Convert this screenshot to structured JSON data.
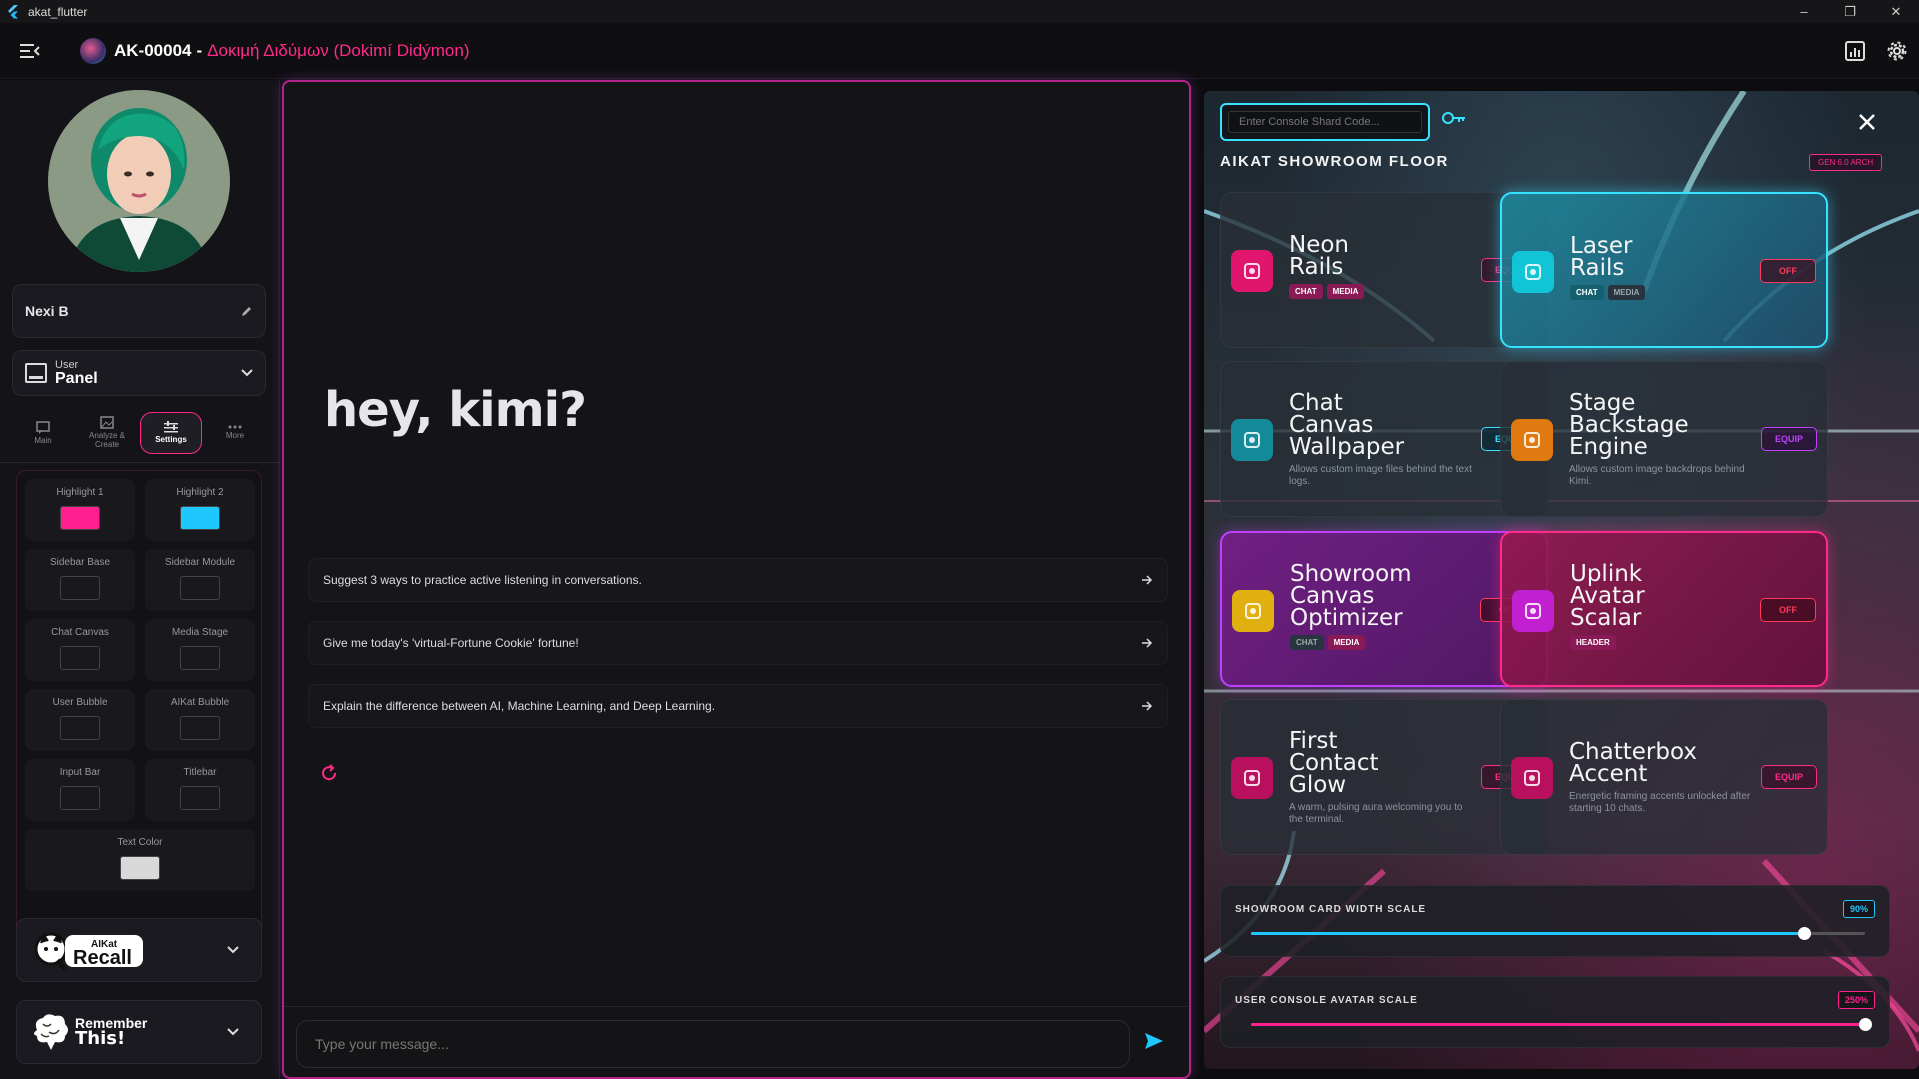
{
  "os": {
    "title": "akat_flutter"
  },
  "appbar": {
    "code": "AK-00004",
    "separator": "-",
    "subtitle": "Δοκιμή Διδύμων (Dokimí Didýmon)"
  },
  "sidebar": {
    "name": "Nexi B",
    "panel_small": "User",
    "panel_big": "Panel",
    "tabs": [
      {
        "label": "Main",
        "icon": "chat-bubble-icon"
      },
      {
        "label": "Analyze & Create",
        "icon": "image-icon"
      },
      {
        "label": "Settings",
        "icon": "sliders-icon"
      },
      {
        "label": "More",
        "icon": "more-dots-icon"
      }
    ],
    "colors": [
      {
        "label": "Highlight 1",
        "value": "#ff1f8e"
      },
      {
        "label": "Highlight 2",
        "value": "#1ec8ff"
      },
      {
        "label": "Sidebar Base",
        "value": "#18181d"
      },
      {
        "label": "Sidebar Module",
        "value": "#18181d"
      },
      {
        "label": "Chat Canvas",
        "value": "#18181d"
      },
      {
        "label": "Media Stage",
        "value": "#18181d"
      },
      {
        "label": "User Bubble",
        "value": "#18181d"
      },
      {
        "label": "AIKat Bubble",
        "value": "#18181d"
      },
      {
        "label": "Input Bar",
        "value": "#18181d"
      },
      {
        "label": "Titlebar",
        "value": "#18181d"
      },
      {
        "label": "Text Color",
        "value": "#d8d8d8"
      }
    ],
    "recall": {
      "top": "AIKat",
      "bottom": "Recall"
    },
    "remember": {
      "top": "Remember",
      "bottom": "This!"
    }
  },
  "chat": {
    "greeting": "hey, kimi?",
    "suggestions": [
      "Suggest 3 ways to practice active listening in conversations.",
      "Give me today's 'virtual-Fortune Cookie' fortune!",
      "Explain the difference between AI, Machine Learning, and Deep Learning."
    ],
    "input_placeholder": "Type your message..."
  },
  "showroom": {
    "code_placeholder": "Enter Console Shard Code...",
    "title": "AIKAT SHOWROOM FLOOR",
    "gen_badge": "GEN 6.0 ARCH",
    "cards": [
      {
        "title_lines": [
          "Neon",
          "Rails"
        ],
        "desc": "",
        "tags": [
          "CHAT",
          "MEDIA"
        ],
        "action": "EQUIP",
        "theme": "dark",
        "icon_color": "#e0156e",
        "icon": "rails-icon"
      },
      {
        "title_lines": [
          "Laser",
          "Rails"
        ],
        "desc": "",
        "tags": [
          "CHAT",
          "MEDIA"
        ],
        "action": "OFF",
        "theme": "teal",
        "icon_color": "#12c5d6",
        "icon": "laser-icon"
      },
      {
        "title_lines": [
          "Chat",
          "Canvas",
          "Wallpaper"
        ],
        "desc": "Allows custom image files behind the text logs.",
        "tags": [],
        "action": "EQUIP",
        "theme": "dark",
        "icon_color": "#148a9a",
        "icon": "wallpaper-icon"
      },
      {
        "title_lines": [
          "Stage",
          "Backstage",
          "Engine"
        ],
        "desc": "Allows custom image backdrops behind Kimi.",
        "tags": [],
        "action": "EQUIP",
        "theme": "dark",
        "icon_color": "#e07a10",
        "icon": "stage-icon"
      },
      {
        "title_lines": [
          "Showroom",
          "Canvas",
          "Optimizer"
        ],
        "desc": "",
        "tags": [
          "CHAT",
          "MEDIA"
        ],
        "action": "OFF",
        "theme": "purple",
        "icon_color": "#e0b010",
        "icon": "canvas-icon"
      },
      {
        "title_lines": [
          "Uplink",
          "Avatar",
          "Scalar"
        ],
        "desc": "",
        "tags": [
          "HEADER"
        ],
        "action": "OFF",
        "theme": "magenta",
        "icon_color": "#c020d0",
        "icon": "avatar-icon"
      },
      {
        "title_lines": [
          "First",
          "Contact",
          "Glow"
        ],
        "desc": "A warm, pulsing aura welcoming you to the terminal.",
        "tags": [],
        "action": "EQUIP",
        "theme": "dark",
        "icon_color": "#b8105e",
        "icon": "puzzle-icon"
      },
      {
        "title_lines": [
          "Chatterbox",
          "Accent"
        ],
        "desc": "Energetic framing accents unlocked after starting 10 chats.",
        "tags": [],
        "action": "EQUIP",
        "theme": "dark",
        "icon_color": "#b8105e",
        "icon": "puzzle-icon"
      }
    ],
    "sliders": [
      {
        "label": "SHOWROOM CARD WIDTH SCALE",
        "value_text": "90%",
        "fraction": 0.9,
        "color": "#1ec8ff"
      },
      {
        "label": "USER CONSOLE AVATAR SCALE",
        "value_text": "250%",
        "fraction": 1.0,
        "color": "#ff1f8e"
      }
    ]
  }
}
